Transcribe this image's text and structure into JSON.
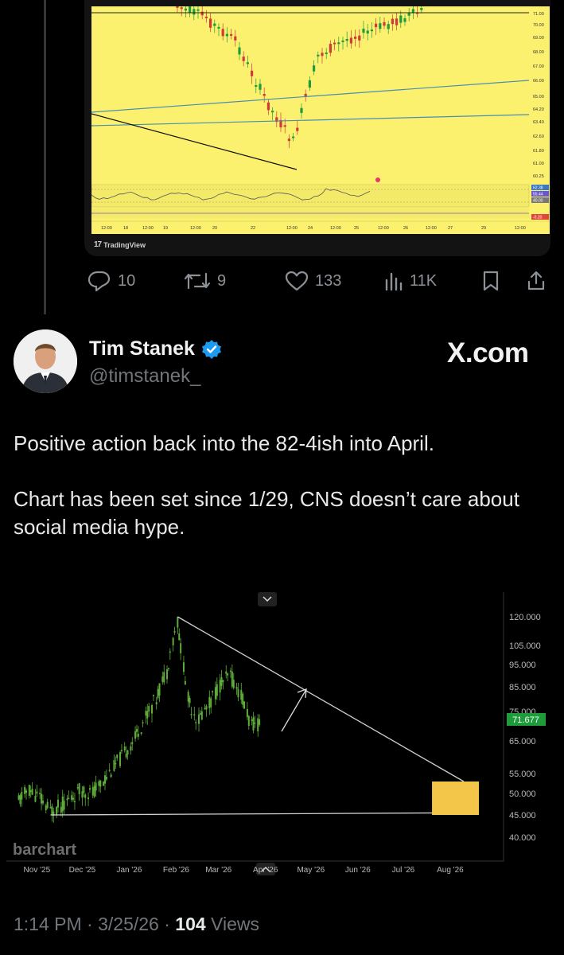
{
  "thread_chart": {
    "y_ticks": [
      "71.00",
      "70.00",
      "69.00",
      "68.00",
      "67.00",
      "66.00",
      "65.00",
      "64.20",
      "63.40",
      "62.60",
      "61.80",
      "61.00",
      "60.25"
    ],
    "osc_labels": [
      "62.38",
      "55.44",
      "40.00",
      "-0.20"
    ],
    "x_ticks": [
      "12:00",
      "18",
      "12:00",
      "19",
      "12:00",
      "20",
      "22",
      "12:00",
      "24",
      "12:00",
      "25",
      "12:00",
      "26",
      "12:00",
      "27",
      "29",
      "12:00"
    ],
    "footer": "TradingView",
    "bg_color": "#fbf16f"
  },
  "actions": {
    "replies": "10",
    "reposts": "9",
    "likes": "133",
    "views": "11K"
  },
  "author": {
    "name": "Tim Stanek",
    "handle": "@timstanek_",
    "watermark": "X.com"
  },
  "tweet": {
    "line1": "Positive action back into the 82-4ish into April.",
    "line2": "Chart has been set since 1/29, CNS doesn’t care about social media hype."
  },
  "chart_data": {
    "type": "candlestick",
    "source_label": "barchart",
    "x_ticks": [
      "Nov '25",
      "Dec '25",
      "Jan '26",
      "Feb '26",
      "Mar '26",
      "Apr '26",
      "May '26",
      "Jun '26",
      "Jul '26",
      "Aug '26"
    ],
    "y_ticks": [
      "120.000",
      "105.000",
      "95.000",
      "85.000",
      "75.000",
      "65.000",
      "55.000",
      "50.000",
      "45.000",
      "40.000"
    ],
    "last_price": "71.677",
    "series": [
      {
        "date": "2025-10-20",
        "close": 48
      },
      {
        "date": "2025-10-27",
        "close": 51
      },
      {
        "date": "2025-11-03",
        "close": 49
      },
      {
        "date": "2025-11-10",
        "close": 46
      },
      {
        "date": "2025-11-17",
        "close": 47
      },
      {
        "date": "2025-11-24",
        "close": 49
      },
      {
        "date": "2025-12-01",
        "close": 51
      },
      {
        "date": "2025-12-08",
        "close": 50
      },
      {
        "date": "2025-12-15",
        "close": 53
      },
      {
        "date": "2025-12-22",
        "close": 57
      },
      {
        "date": "2025-12-29",
        "close": 61
      },
      {
        "date": "2026-01-05",
        "close": 66
      },
      {
        "date": "2026-01-12",
        "close": 73
      },
      {
        "date": "2026-01-19",
        "close": 80
      },
      {
        "date": "2026-01-26",
        "close": 92
      },
      {
        "date": "2026-02-02",
        "close": 118
      },
      {
        "date": "2026-02-09",
        "close": 80
      },
      {
        "date": "2026-02-16",
        "close": 72
      },
      {
        "date": "2026-02-23",
        "close": 78
      },
      {
        "date": "2026-03-02",
        "close": 86
      },
      {
        "date": "2026-03-09",
        "close": 90
      },
      {
        "date": "2026-03-16",
        "close": 82
      },
      {
        "date": "2026-03-23",
        "close": 70
      },
      {
        "date": "2026-03-30",
        "close": 71.677
      }
    ],
    "trendline_upper": {
      "from": {
        "date": "2026-02-02",
        "value": 121
      },
      "to": {
        "date": "2026-08-10",
        "value": 53
      }
    },
    "trendline_lower": {
      "from": {
        "date": "2025-11-10",
        "value": 45
      },
      "to": {
        "date": "2026-08-10",
        "value": 45.5
      }
    },
    "target_box": {
      "date_from": "2026-07-20",
      "date_to": "2026-08-20",
      "low": 45,
      "high": 53
    },
    "target_color": "#f3c64a",
    "last_price_color": "#1e9c3b"
  },
  "timestamp": {
    "time": "1:14 PM · 3/25/26 ·",
    "views_count": "104",
    "views_label": "Views"
  }
}
